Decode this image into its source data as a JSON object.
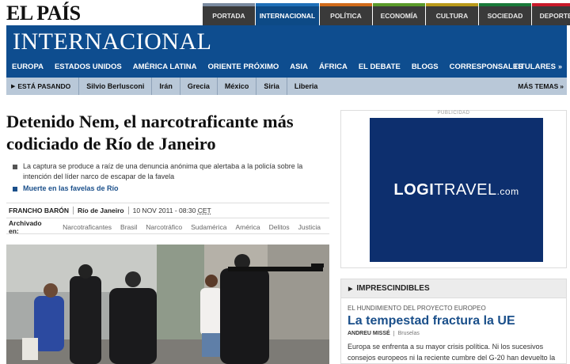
{
  "header": {
    "logo": "EL PAÍS",
    "sections": [
      "PORTADA",
      "INTERNACIONAL",
      "POLÍTICA",
      "ECONOMÍA",
      "CULTURA",
      "SOCIEDAD",
      "DEPORTES"
    ],
    "active_section": "INTERNACIONAL"
  },
  "band": {
    "title": "INTERNACIONAL",
    "regions": [
      "EUROPA",
      "ESTADOS UNIDOS",
      "AMÉRICA LATINA",
      "ORIENTE PRÓXIMO",
      "ASIA",
      "ÁFRICA",
      "EL DEBATE",
      "BLOGS",
      "CORRESPONSALES"
    ],
    "titulares": "TITULARES"
  },
  "trending": {
    "label": "ESTÁ PASANDO",
    "topics": [
      "Silvio Berlusconi",
      "Irán",
      "Grecia",
      "México",
      "Siria",
      "Liberia"
    ],
    "more": "MÁS TEMAS"
  },
  "article": {
    "headline": "Detenido Nem, el narcotraficante más codiciado de Río de Janeiro",
    "summary": "La captura se produce a raíz de una denuncia anónima que alertaba a la policía sobre la intención del líder narco de escapar de la favela",
    "related_link": "Muerte en las favelas de Río",
    "author": "FRANCHO BARÓN",
    "place": "Río de Janeiro",
    "date": "10 NOV 2011 - 08:30",
    "timezone": "CET",
    "archive_label": "Archivado en:",
    "tags": [
      "Narcotraficantes",
      "Brasil",
      "Narcotráfico",
      "Sudamérica",
      "América",
      "Delitos",
      "Justicia"
    ]
  },
  "ad": {
    "label": "PUBLICIDAD",
    "brand_logi": "LOGI",
    "brand_travel": "TRAVEL",
    "brand_com": ".com",
    "color": "#0d2f6e"
  },
  "imprescindibles": {
    "heading": "IMPRESCINDIBLES",
    "kicker": "EL HUNDIMIENTO DEL PROYECTO EUROPEO",
    "title": "La tempestad fractura la UE",
    "author": "ANDREU MISSÉ",
    "place": "Bruselas",
    "text": "Europa se enfrenta a su mayor crisis política. Ni los sucesivos consejos europeos ni la reciente cumbre del G-20 han devuelto la"
  },
  "colors": {
    "band_blue": "#0e4d8f",
    "trend_bar": "#b9c8d8",
    "link_blue": "#1a4f8a"
  }
}
